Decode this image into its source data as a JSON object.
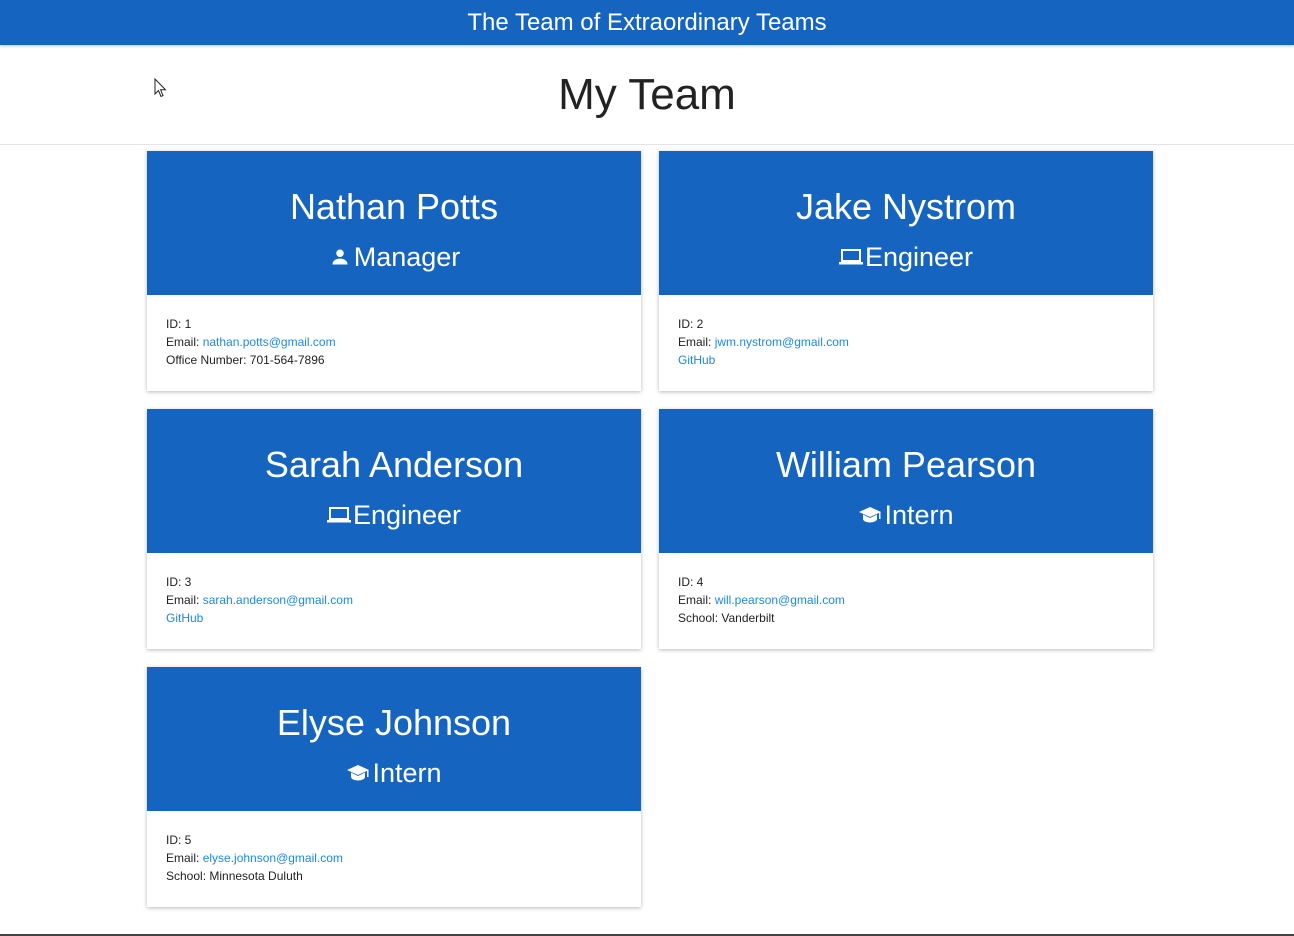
{
  "header": {
    "title": "The Team of Extraordinary Teams"
  },
  "page": {
    "title": "My Team"
  },
  "colors": {
    "accent": "#1565c0",
    "link": "#1e88e5"
  },
  "employees": [
    {
      "name": "Nathan Potts",
      "role": "Manager",
      "role_icon": "person-icon",
      "id_text": "ID: 1",
      "email_label": "Email: ",
      "email": "nathan.potts@gmail.com",
      "extra_label": "Office Number: 701-564-7896",
      "extra_is_link": false
    },
    {
      "name": "Jake Nystrom",
      "role": "Engineer",
      "role_icon": "laptop-icon",
      "id_text": "ID: 2",
      "email_label": "Email: ",
      "email": "jwm.nystrom@gmail.com",
      "extra_label": "GitHub",
      "extra_is_link": true
    },
    {
      "name": "Sarah Anderson",
      "role": "Engineer",
      "role_icon": "laptop-icon",
      "id_text": "ID: 3",
      "email_label": "Email: ",
      "email": "sarah.anderson@gmail.com",
      "extra_label": "GitHub",
      "extra_is_link": true
    },
    {
      "name": "William Pearson",
      "role": "Intern",
      "role_icon": "graduation-cap-icon",
      "id_text": "ID: 4",
      "email_label": "Email: ",
      "email": "will.pearson@gmail.com",
      "extra_label": "School: Vanderbilt",
      "extra_is_link": false
    },
    {
      "name": "Elyse Johnson",
      "role": "Intern",
      "role_icon": "graduation-cap-icon",
      "id_text": "ID: 5",
      "email_label": "Email: ",
      "email": "elyse.johnson@gmail.com",
      "extra_label": "School: Minnesota Duluth",
      "extra_is_link": false
    }
  ]
}
